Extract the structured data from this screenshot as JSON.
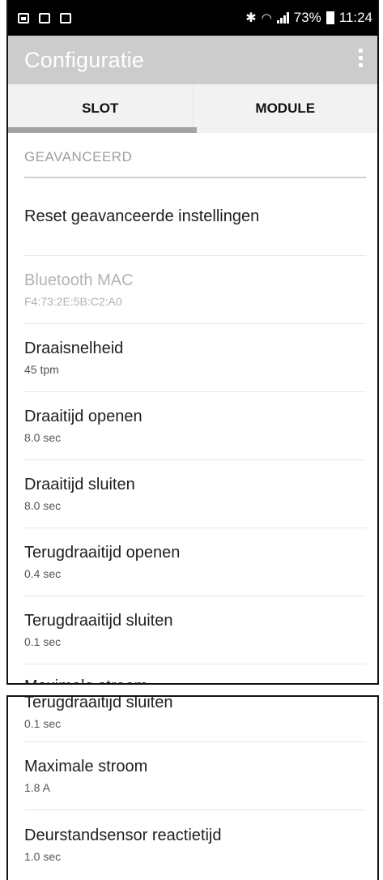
{
  "status_bar": {
    "bluetooth_icon": "bluetooth-icon",
    "wifi_icon": "wifi-icon",
    "battery_percent": "73%",
    "time": "11:24"
  },
  "app_bar": {
    "title": "Configuratie"
  },
  "tabs": [
    {
      "label": "SLOT",
      "selected": true
    },
    {
      "label": "MODULE",
      "selected": false
    }
  ],
  "section": {
    "header": "GEAVANCEERD"
  },
  "settings": {
    "reset": {
      "title": "Reset geavanceerde instellingen"
    },
    "bluetooth_mac": {
      "title": "Bluetooth MAC",
      "value": "F4:73:2E:5B:C2:A0"
    },
    "draaisnelheid": {
      "title": "Draaisnelheid",
      "value": "45 tpm"
    },
    "draaitijd_openen": {
      "title": "Draaitijd openen",
      "value": "8.0 sec"
    },
    "draaitijd_sluiten": {
      "title": "Draaitijd sluiten",
      "value": "8.0 sec"
    },
    "terugdraaitijd_openen": {
      "title": "Terugdraaitijd openen",
      "value": "0.4 sec"
    },
    "terugdraaitijd_sluiten": {
      "title": "Terugdraaitijd sluiten",
      "value": "0.1 sec"
    },
    "maximale_stroom": {
      "title": "Maximale stroom",
      "value": "1.8 A"
    },
    "deurstandsensor": {
      "title": "Deurstandsensor reactietijd",
      "value": "1.0 sec"
    }
  },
  "colors": {
    "status_bar_bg": "#000000",
    "app_bar_bg": "#cccccc",
    "tab_indicator": "#a3a3a3",
    "section_header": "#9e9e9e",
    "disabled_text": "#b3b3b3"
  }
}
